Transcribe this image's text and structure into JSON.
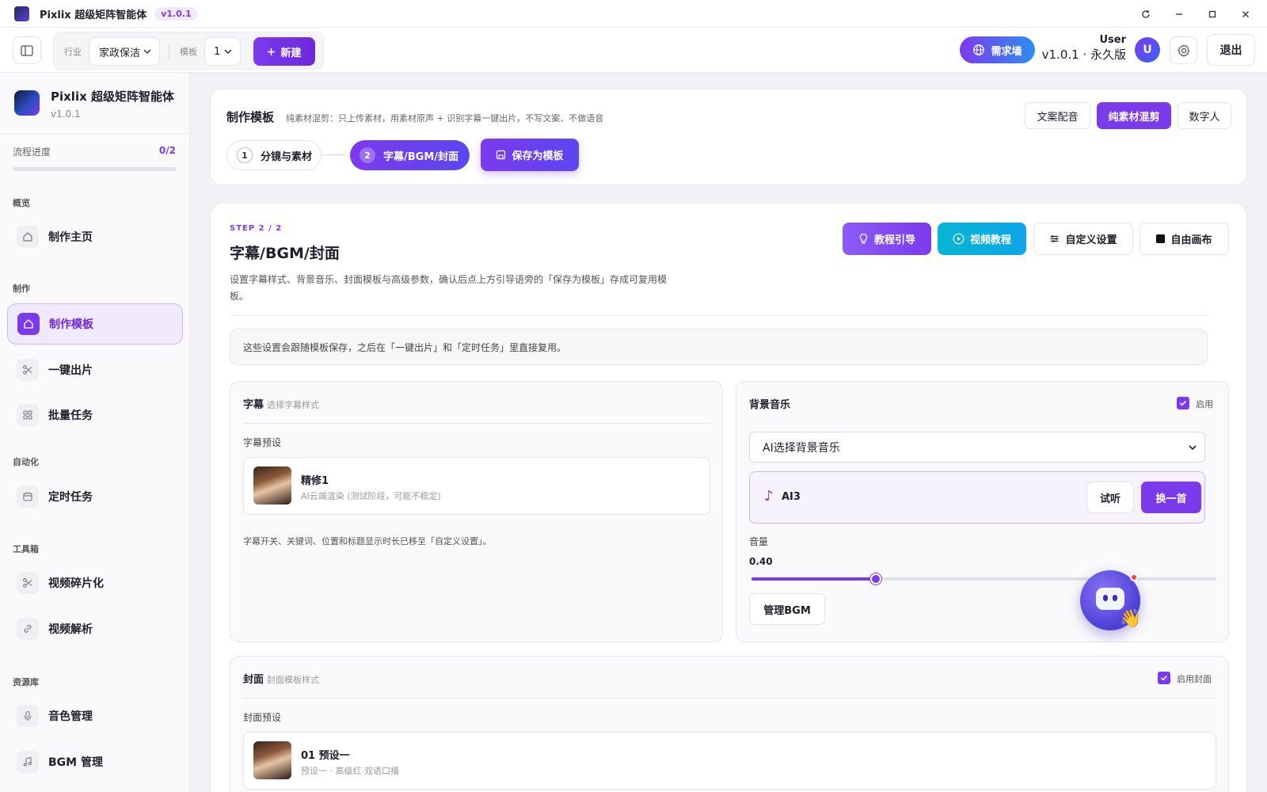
{
  "titlebar": {
    "app_name": "Pixlix 超级矩阵智能体",
    "version_badge": "v1.0.1",
    "icons": [
      "refresh-icon",
      "minimize-icon",
      "maximize-icon",
      "close-icon"
    ]
  },
  "toolbar": {
    "industry_label": "行业",
    "industry_value": "家政保洁",
    "template_label": "模板",
    "template_value": "1",
    "new_button": "新建",
    "demand_wall_button": "需求墙",
    "user_name": "User",
    "user_version": "v1.0.1 · 永久版",
    "avatar_letter": "U",
    "logout_button": "退出"
  },
  "sidebar": {
    "brand_title": "Pixlix 超级矩阵智能体",
    "brand_version": "v1.0.1",
    "progress_label": "流程进度",
    "progress_value": "0/2",
    "progress_fraction": 0,
    "sections": {
      "overview": "概览",
      "production": "制作",
      "automation": "自动化",
      "toolbox": "工具箱",
      "library": "资源库"
    },
    "items": {
      "home": "制作主页",
      "make_template": "制作模板",
      "one_click": "一键出片",
      "batch": "批量任务",
      "scheduled": "定时任务",
      "fragment": "视频碎片化",
      "parse": "视频解析",
      "voice": "音色管理",
      "bgm": "BGM 管理"
    }
  },
  "template_card": {
    "title": "制作模板",
    "description": "纯素材混剪：只上传素材，用素材原声 + 识别字幕一键出片，不写文案、不做语音",
    "modes": [
      "文案配音",
      "纯素材混剪",
      "数字人"
    ],
    "active_mode": "纯素材混剪",
    "steps": [
      {
        "num": "1",
        "label": "分镜与素材"
      },
      {
        "num": "2",
        "label": "字幕/BGM/封面"
      }
    ],
    "save_button": "保存为模板"
  },
  "step_card": {
    "tag": "STEP 2 / 2",
    "title": "字幕/BGM/封面",
    "description": "设置字幕样式、背景音乐、封面模板与高级参数，确认后点上方引导语旁的「保存为模板」存成可复用模板。",
    "buttons": {
      "tutorial_guide": "教程引导",
      "video_tutorial": "视频教程",
      "custom_settings": "自定义设置",
      "free_canvas": "自由画布"
    },
    "info": "这些设置会跟随模板保存，之后在「一键出片」和「定时任务」里直接复用。"
  },
  "subtitle_panel": {
    "title": "字幕",
    "subtitle": "选择字幕样式",
    "preset_label": "字幕预设",
    "preset_name": "精修1",
    "preset_desc": "AI云端渲染 (测试阶段，可能不稳定)",
    "note": "字幕开关、关键词、位置和标题显示时长已移至「自定义设置」。"
  },
  "bgm_panel": {
    "title": "背景音乐",
    "enable_label": "启用",
    "enabled": true,
    "select_value": "AI选择背景音乐",
    "track_name": "AI3",
    "try_button": "试听",
    "switch_button": "换一首",
    "volume_label": "音量",
    "volume_value": "0.40",
    "volume": 0.4,
    "volume_max": 1.5,
    "manage_button": "管理BGM"
  },
  "cover_panel": {
    "title": "封面",
    "subtitle": "封面模板样式",
    "enable_label": "启用封面",
    "enabled": true,
    "preset_label": "封面预设",
    "preset_name": "01 预设一",
    "preset_desc": "预设一 · 高级红·双语口播"
  },
  "colors": {
    "accent": "#7c3aed",
    "cyan": "#06b6d4",
    "blue": "#2d8ff0"
  }
}
